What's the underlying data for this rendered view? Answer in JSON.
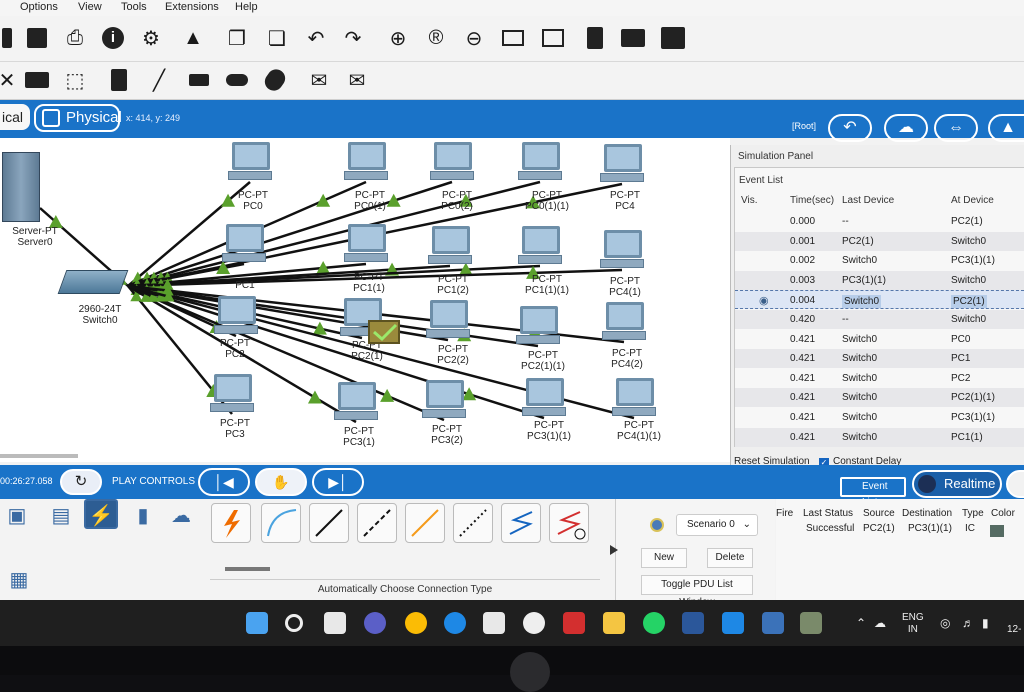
{
  "menu": {
    "items": [
      "Options",
      "View",
      "Tools",
      "Extensions",
      "Help"
    ]
  },
  "toolbar1": {
    "icons": [
      "save-icon",
      "print-icon",
      "info-icon",
      "network-wizard-icon",
      "activity-wizard-icon",
      "copy-icon",
      "paste-icon",
      "undo-icon",
      "redo-icon",
      "zoom-in-icon",
      "zoom-reset-icon",
      "zoom-out-icon",
      "drawing-palette-icon",
      "custom-device-icon",
      "document-icon",
      "server-rack-icon",
      "cloud-icon"
    ]
  },
  "toolbar2": {
    "icons": [
      "select-icon",
      "delete-icon",
      "inspect-icon",
      "note-icon",
      "line-icon",
      "rectangle-icon",
      "ellipse-icon",
      "freeform-icon",
      "simple-pdu-icon",
      "complex-pdu-icon"
    ]
  },
  "workspace": {
    "logical_label": "ical",
    "physical_label": "Physical",
    "coords": "x: 414, y: 249",
    "root_label": "[Root]"
  },
  "devices": [
    {
      "id": "server0",
      "label1": "Server-PT",
      "label2": "Server0",
      "kind": "server"
    },
    {
      "id": "switch0",
      "label1": "2960-24T",
      "label2": "Switch0",
      "kind": "switch"
    },
    {
      "id": "pc0",
      "label1": "PC-PT",
      "label2": "PC0"
    },
    {
      "id": "pc0-1",
      "label1": "PC-PT",
      "label2": "PC0(1)"
    },
    {
      "id": "pc0-2",
      "label1": "PC-PT",
      "label2": "PC0(2)"
    },
    {
      "id": "pc0-1-1",
      "label1": "PC-PT",
      "label2": "PC0(1)(1)"
    },
    {
      "id": "pc4",
      "label1": "PC-PT",
      "label2": "PC4"
    },
    {
      "id": "pc1",
      "label1": "",
      "label2": "PC1"
    },
    {
      "id": "pc1-1",
      "label1": "PC-PT",
      "label2": "PC1(1)"
    },
    {
      "id": "pc1-2",
      "label1": "PC-PT",
      "label2": "PC1(2)"
    },
    {
      "id": "pc1-1-1",
      "label1": "PC-PT",
      "label2": "PC1(1)(1)"
    },
    {
      "id": "pc4-1",
      "label1": "PC-PT",
      "label2": "PC4(1)"
    },
    {
      "id": "pc2",
      "label1": "PC-PT",
      "label2": "PC2"
    },
    {
      "id": "pc2-1",
      "label1": "PC-PT",
      "label2": "PC2(1)"
    },
    {
      "id": "pc2-2",
      "label1": "PC-PT",
      "label2": "PC2(2)"
    },
    {
      "id": "pc2-1-1",
      "label1": "PC-PT",
      "label2": "PC2(1)(1)"
    },
    {
      "id": "pc4-2",
      "label1": "PC-PT",
      "label2": "PC4(2)"
    },
    {
      "id": "pc3",
      "label1": "PC-PT",
      "label2": "PC3"
    },
    {
      "id": "pc3-1",
      "label1": "PC-PT",
      "label2": "PC3(1)"
    },
    {
      "id": "pc3-2",
      "label1": "PC-PT",
      "label2": "PC3(2)"
    },
    {
      "id": "pc3-1-1",
      "label1": "PC-PT",
      "label2": "PC3(1)(1)"
    },
    {
      "id": "pc4-1-1",
      "label1": "PC-PT",
      "label2": "PC4(1)(1)"
    }
  ],
  "simulation": {
    "title": "Simulation Panel",
    "event_list_label": "Event List",
    "headers": {
      "vis": "Vis.",
      "time": "Time(sec)",
      "last": "Last Device",
      "at": "At Device"
    },
    "events": [
      {
        "time": "0.000",
        "last": "--",
        "at": "PC2(1)"
      },
      {
        "time": "0.001",
        "last": "PC2(1)",
        "at": "Switch0"
      },
      {
        "time": "0.002",
        "last": "Switch0",
        "at": "PC3(1)(1)"
      },
      {
        "time": "0.003",
        "last": "PC3(1)(1)",
        "at": "Switch0"
      },
      {
        "time": "0.004",
        "last": "Switch0",
        "at": "PC2(1)",
        "selected": true
      },
      {
        "time": "0.420",
        "last": "--",
        "at": "Switch0"
      },
      {
        "time": "0.421",
        "last": "Switch0",
        "at": "PC0"
      },
      {
        "time": "0.421",
        "last": "Switch0",
        "at": "PC1"
      },
      {
        "time": "0.421",
        "last": "Switch0",
        "at": "PC2"
      },
      {
        "time": "0.421",
        "last": "Switch0",
        "at": "PC2(1)(1)"
      },
      {
        "time": "0.421",
        "last": "Switch0",
        "at": "PC3(1)(1)"
      },
      {
        "time": "0.421",
        "last": "Switch0",
        "at": "PC1(1)"
      }
    ],
    "reset_label": "Reset Simulation",
    "constant_delay_label": "Constant Delay"
  },
  "play": {
    "time": "00:26:27.058",
    "label": "PLAY CONTROLS",
    "event_list_btn": "Event List",
    "realtime_btn": "Realtime"
  },
  "connections": {
    "auto_label": "Automatically Choose Connection Type"
  },
  "scenario": {
    "select_value": "Scenario 0",
    "new_label": "New",
    "delete_label": "Delete",
    "toggle_label": "Toggle PDU List Window"
  },
  "pdu_list": {
    "headers": [
      "Fire",
      "Last Status",
      "Source",
      "Destination",
      "Type",
      "Color"
    ],
    "row": {
      "status": "Successful",
      "source": "PC2(1)",
      "destination": "PC3(1)(1)",
      "type": "IC"
    }
  },
  "taskbar": {
    "lang1": "ENG",
    "lang2": "IN",
    "time": "12-"
  },
  "colors": {
    "accent": "#1a73c8",
    "link_green": "#5aa02c",
    "cable": "#111111"
  }
}
